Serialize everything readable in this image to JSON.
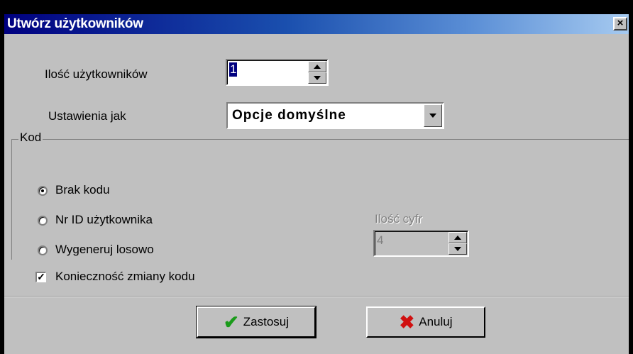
{
  "window": {
    "title": "Utwórz użytkowników",
    "close_glyph": "×"
  },
  "form": {
    "user_count_label": "Ilość użytkowników",
    "user_count_value": "1",
    "settings_label": "Ustawienia jak",
    "settings_value": "Opcje domyślne"
  },
  "code_group": {
    "title": "Kod",
    "options": [
      {
        "label": "Brak kodu",
        "checked": true
      },
      {
        "label": "Nr ID użytkownika",
        "checked": false
      },
      {
        "label": "Wygeneruj losowo",
        "checked": false
      }
    ],
    "digits_label": "Ilość cyfr",
    "digits_value": "4",
    "force_change_label": "Konieczność zmiany kodu",
    "force_change_checked": true
  },
  "buttons": {
    "apply": "Zastosuj",
    "cancel": "Anuluj"
  },
  "icons": {
    "apply": "check-icon",
    "cancel": "x-icon",
    "close": "close-icon"
  },
  "colors": {
    "title_gradient_start": "#000080",
    "title_gradient_end": "#a6caf0",
    "face": "#c0c0c0",
    "apply_icon": "#1a9b1a",
    "cancel_icon": "#d01010"
  }
}
